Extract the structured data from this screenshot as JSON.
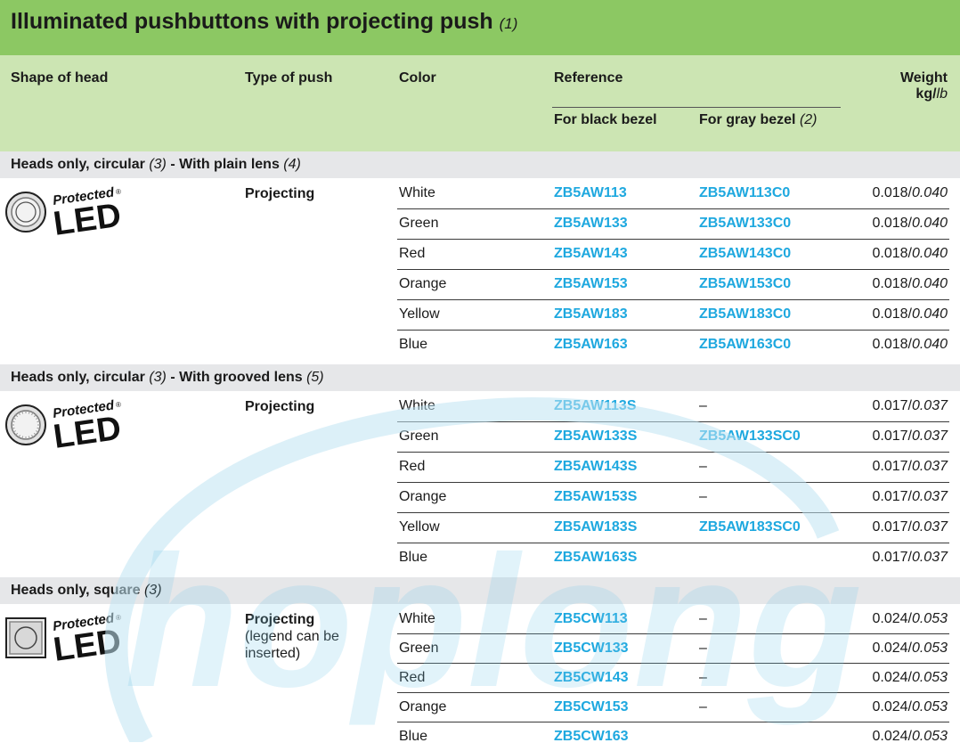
{
  "title": "Illuminated pushbuttons with projecting push",
  "title_note": "(1)",
  "headers": {
    "shape": "Shape of head",
    "type": "Type of push",
    "color": "Color",
    "reference": "Reference",
    "weight": "Weight",
    "weight_unit_kg": "kg/",
    "weight_unit_lb": "lb",
    "black_bezel": "For black bezel",
    "gray_bezel": "For gray bezel",
    "gray_bezel_note": "(2)"
  },
  "logo": {
    "word_top": "Protected",
    "word_bottom": "LED",
    "mark": "®"
  },
  "watermark": "hoplong",
  "sections": [
    {
      "title_a": "Heads only, circular",
      "note_a": "(3)",
      "title_b": "- With plain lens",
      "note_b": "(4)",
      "push_bold": "Projecting",
      "push_extra": "",
      "rows": [
        {
          "color": "White",
          "black": "ZB5AW113",
          "gray": "ZB5AW113C0",
          "kg": "0.018/",
          "lb": "0.040"
        },
        {
          "color": "Green",
          "black": "ZB5AW133",
          "gray": "ZB5AW133C0",
          "kg": "0.018/",
          "lb": "0.040"
        },
        {
          "color": "Red",
          "black": "ZB5AW143",
          "gray": "ZB5AW143C0",
          "kg": "0.018/",
          "lb": "0.040"
        },
        {
          "color": "Orange",
          "black": "ZB5AW153",
          "gray": "ZB5AW153C0",
          "kg": "0.018/",
          "lb": "0.040"
        },
        {
          "color": "Yellow",
          "black": "ZB5AW183",
          "gray": "ZB5AW183C0",
          "kg": "0.018/",
          "lb": "0.040"
        },
        {
          "color": "Blue",
          "black": "ZB5AW163",
          "gray": "ZB5AW163C0",
          "kg": "0.018/",
          "lb": "0.040"
        }
      ]
    },
    {
      "title_a": "Heads only, circular",
      "note_a": "(3)",
      "title_b": "- With grooved lens",
      "note_b": "(5)",
      "push_bold": "Projecting",
      "push_extra": "",
      "rows": [
        {
          "color": "White",
          "black": "ZB5AW113S",
          "gray": "–",
          "kg": "0.017/",
          "lb": "0.037"
        },
        {
          "color": "Green",
          "black": "ZB5AW133S",
          "gray": "ZB5AW133SC0",
          "kg": "0.017/",
          "lb": "0.037"
        },
        {
          "color": "Red",
          "black": "ZB5AW143S",
          "gray": "–",
          "kg": "0.017/",
          "lb": "0.037"
        },
        {
          "color": "Orange",
          "black": "ZB5AW153S",
          "gray": "–",
          "kg": "0.017/",
          "lb": "0.037"
        },
        {
          "color": "Yellow",
          "black": "ZB5AW183S",
          "gray": "ZB5AW183SC0",
          "kg": "0.017/",
          "lb": "0.037"
        },
        {
          "color": "Blue",
          "black": "ZB5AW163S",
          "gray": "",
          "kg": "0.017/",
          "lb": "0.037"
        }
      ]
    },
    {
      "title_a": "Heads only, square",
      "note_a": "(3)",
      "title_b": "",
      "note_b": "",
      "push_bold": "Projecting",
      "push_extra": "(legend can be inserted)",
      "rows": [
        {
          "color": "White",
          "black": "ZB5CW113",
          "gray": "–",
          "kg": "0.024/",
          "lb": "0.053"
        },
        {
          "color": "Green",
          "black": "ZB5CW133",
          "gray": "–",
          "kg": "0.024/",
          "lb": "0.053"
        },
        {
          "color": "Red",
          "black": "ZB5CW143",
          "gray": "–",
          "kg": "0.024/",
          "lb": "0.053"
        },
        {
          "color": "Orange",
          "black": "ZB5CW153",
          "gray": "–",
          "kg": "0.024/",
          "lb": "0.053"
        },
        {
          "color": "Blue",
          "black": "ZB5CW163",
          "gray": "",
          "kg": "0.024/",
          "lb": "0.053"
        }
      ]
    }
  ],
  "colors": {
    "title_bg": "#8cc863",
    "header_bg": "#cce5b3",
    "section_bg": "#e6e7e9",
    "reference": "#1ea8df"
  }
}
